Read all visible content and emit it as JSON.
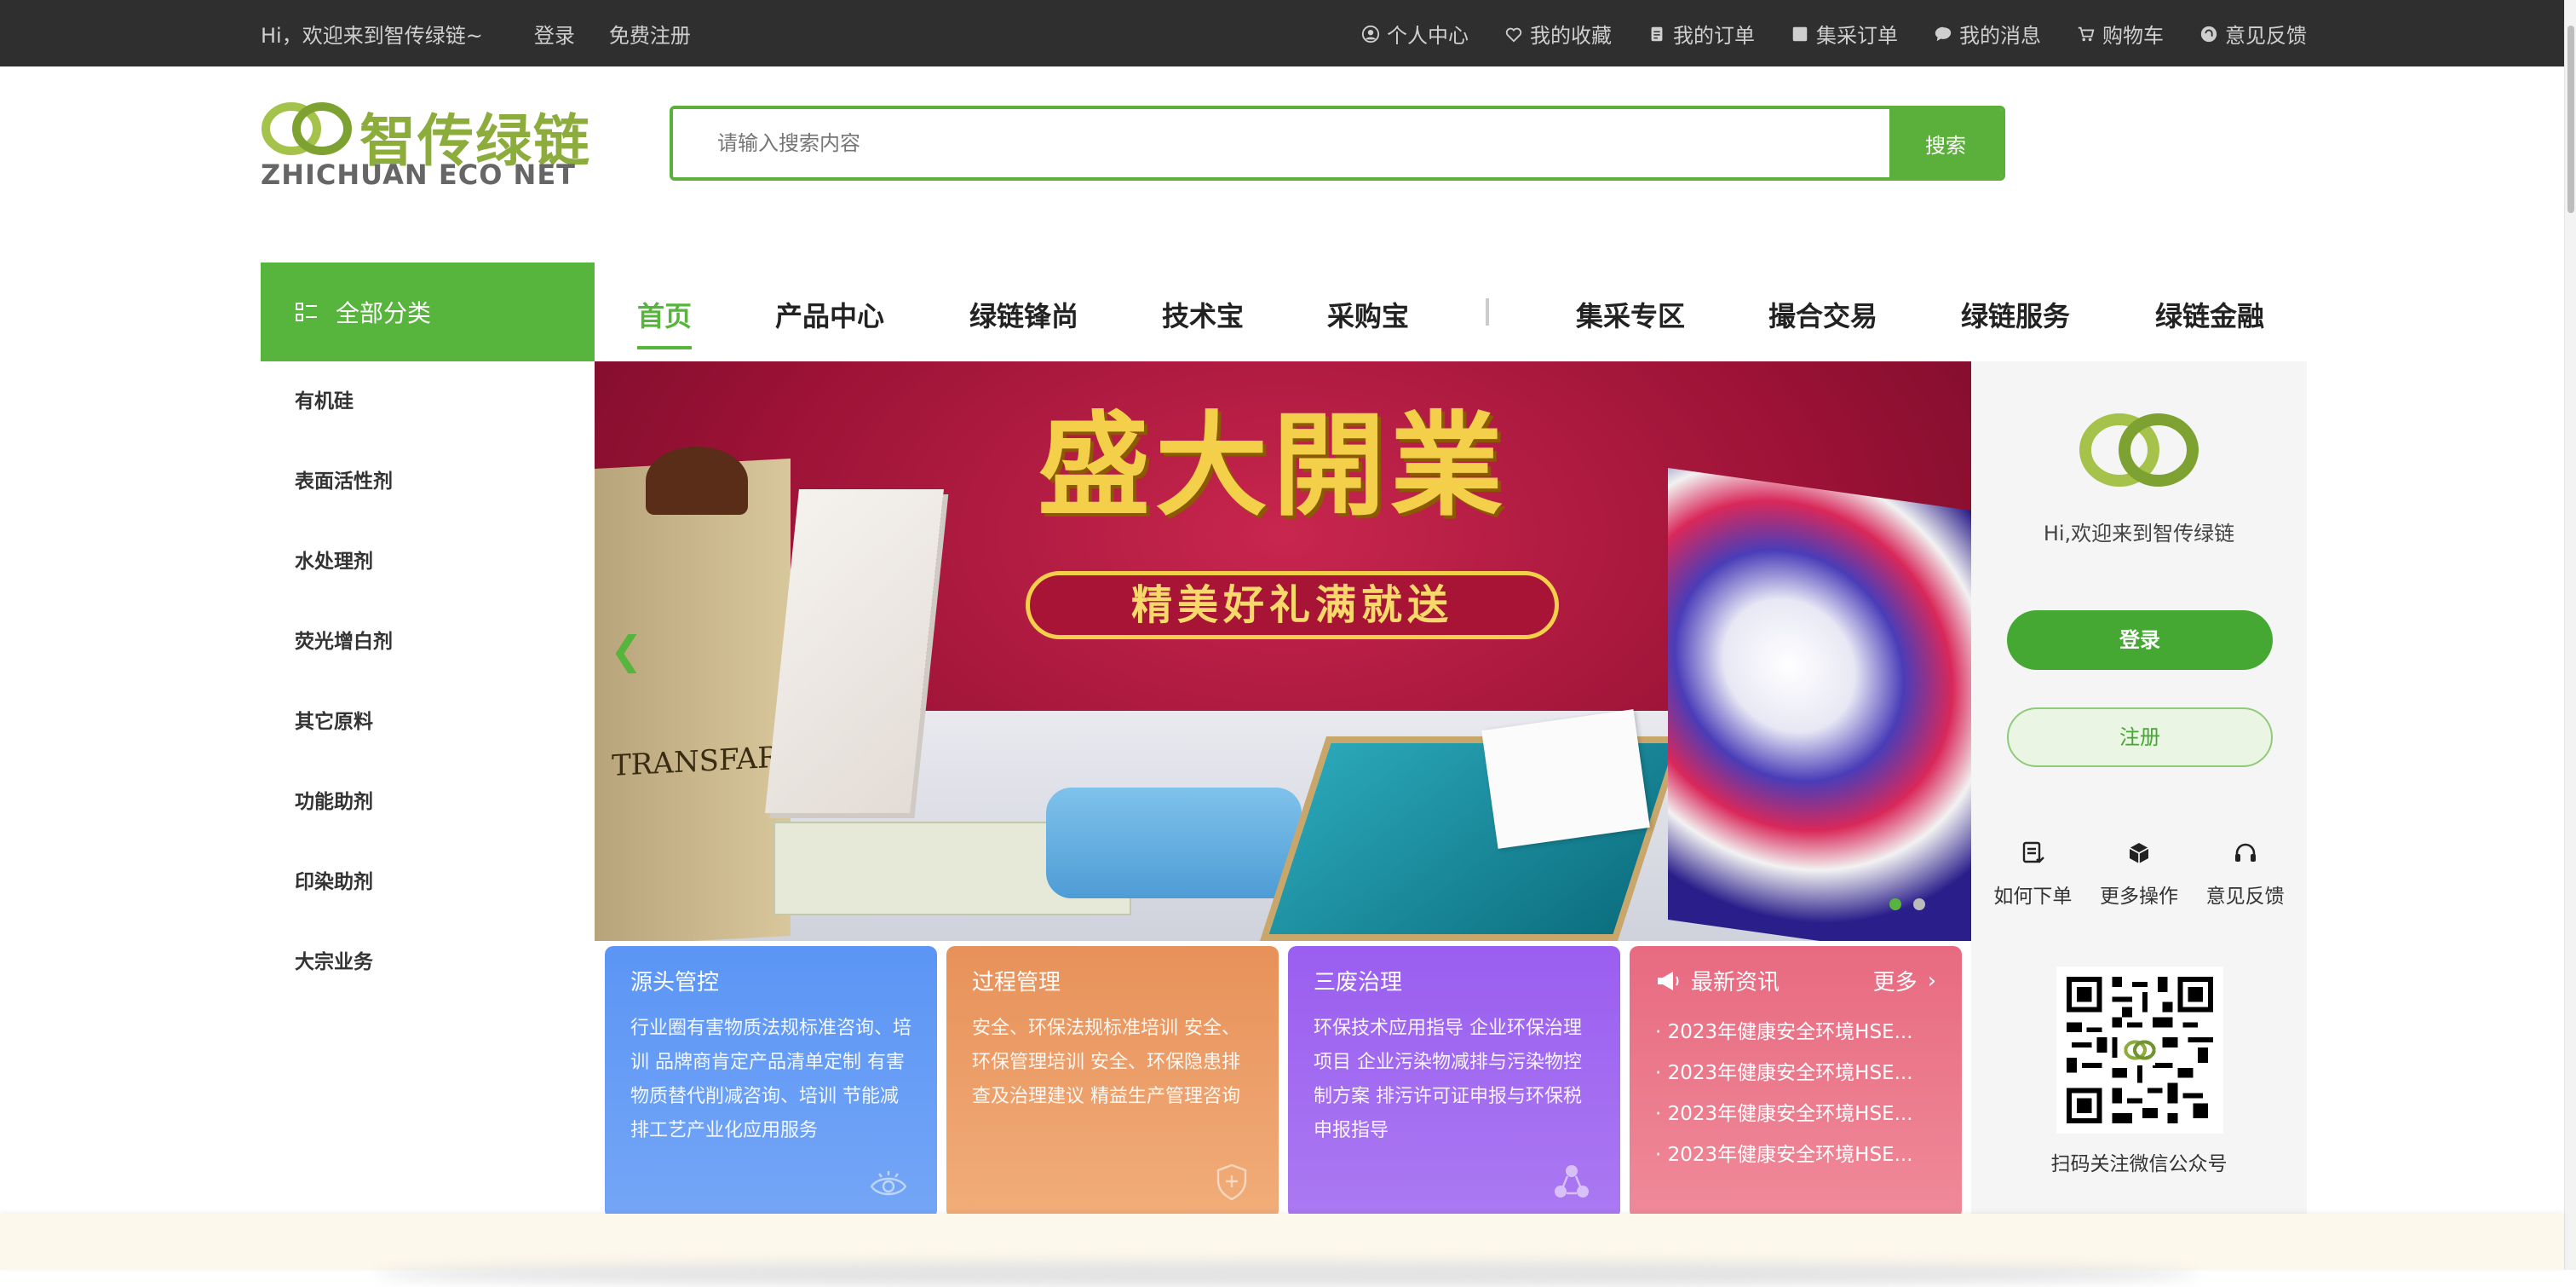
{
  "topbar": {
    "welcome": "Hi，欢迎来到智传绿链~",
    "login": "登录",
    "register": "免费注册",
    "links": [
      {
        "icon": "user-icon",
        "label": "个人中心"
      },
      {
        "icon": "heart-icon",
        "label": "我的收藏"
      },
      {
        "icon": "order-icon",
        "label": "我的订单"
      },
      {
        "icon": "checkbox-icon",
        "label": "集采订单"
      },
      {
        "icon": "message-icon",
        "label": "我的消息"
      },
      {
        "icon": "cart-icon",
        "label": "购物车"
      },
      {
        "icon": "feedback-icon",
        "label": "意见反馈"
      }
    ]
  },
  "brand": {
    "name_cn": "智传绿链",
    "name_en": "ZHICHUAN ECO NET",
    "color": "#8cac3c"
  },
  "search": {
    "placeholder": "请输入搜索内容",
    "button": "搜索"
  },
  "categories": {
    "title": "全部分类",
    "items": [
      "有机硅",
      "表面活性剂",
      "水处理剂",
      "荧光增白剂",
      "其它原料",
      "功能助剂",
      "印染助剂",
      "大宗业务"
    ]
  },
  "nav": {
    "items": [
      "首页",
      "产品中心",
      "绿链锋尚",
      "技术宝",
      "采购宝",
      "集采专区",
      "撮合交易",
      "绿链服务",
      "绿链金融"
    ],
    "active": "首页"
  },
  "banner": {
    "title": "盛大開業",
    "subtitle": "精美好礼满就送",
    "bag_label": "TRANSFAR",
    "slides": 2,
    "active_slide": 1
  },
  "side": {
    "welcome": "Hi,欢迎来到智传绿链",
    "login": "登录",
    "register": "注册",
    "quick": [
      {
        "icon": "order-list-icon",
        "label": "如何下单"
      },
      {
        "icon": "box-icon",
        "label": "更多操作"
      },
      {
        "icon": "headset-icon",
        "label": "意见反馈"
      }
    ],
    "qr_caption": "扫码关注微信公众号"
  },
  "cards": [
    {
      "title": "源头管控",
      "body": "行业圈有害物质法规标准咨询、培训 品牌商肯定产品清单定制 有害物质替代削减咨询、培训 节能减排工艺产业化应用服务",
      "icon": "eye-icon"
    },
    {
      "title": "过程管理",
      "body": "安全、环保法规标准培训 安全、环保管理培训 安全、环保隐患排查及治理建议 精益生产管理咨询",
      "icon": "shield-icon"
    },
    {
      "title": "三废治理",
      "body": "环保技术应用指导 企业环保治理项目 企业污染物减排与污染物控制方案 排污许可证申报与环保税申报指导",
      "icon": "recycle-icon"
    }
  ],
  "news": {
    "title": "最新资讯",
    "more": "更多",
    "items": [
      "· 2023年健康安全环境HSE...",
      "· 2023年健康安全环境HSE...",
      "· 2023年健康安全环境HSE...",
      "· 2023年健康安全环境HSE..."
    ]
  },
  "colors": {
    "accent": "#57b43c",
    "topbar": "#2f2f2f"
  }
}
